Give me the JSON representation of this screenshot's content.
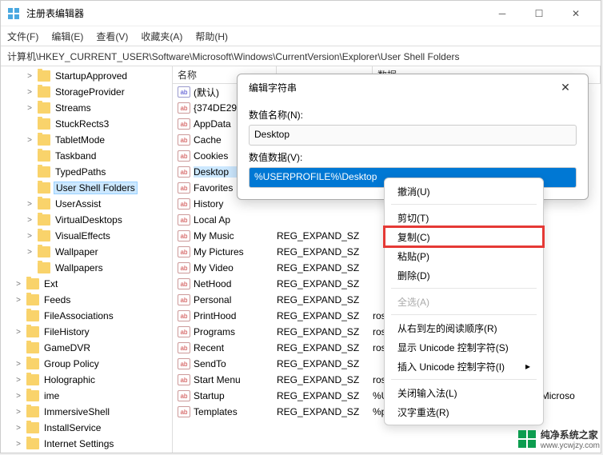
{
  "window": {
    "title": "注册表编辑器",
    "menus": [
      "文件(F)",
      "编辑(E)",
      "查看(V)",
      "收藏夹(A)",
      "帮助(H)"
    ],
    "address": "计算机\\HKEY_CURRENT_USER\\Software\\Microsoft\\Windows\\CurrentVersion\\Explorer\\User Shell Folders"
  },
  "tree": [
    {
      "label": "StartupApproved",
      "lvl": 1,
      "exp": ">"
    },
    {
      "label": "StorageProvider",
      "lvl": 1,
      "exp": ">"
    },
    {
      "label": "Streams",
      "lvl": 1,
      "exp": ">"
    },
    {
      "label": "StuckRects3",
      "lvl": 1,
      "exp": ""
    },
    {
      "label": "TabletMode",
      "lvl": 1,
      "exp": ">"
    },
    {
      "label": "Taskband",
      "lvl": 1,
      "exp": ""
    },
    {
      "label": "TypedPaths",
      "lvl": 1,
      "exp": ""
    },
    {
      "label": "User Shell Folders",
      "lvl": 1,
      "exp": "",
      "selected": true
    },
    {
      "label": "UserAssist",
      "lvl": 1,
      "exp": ">"
    },
    {
      "label": "VirtualDesktops",
      "lvl": 1,
      "exp": ">"
    },
    {
      "label": "VisualEffects",
      "lvl": 1,
      "exp": ">"
    },
    {
      "label": "Wallpaper",
      "lvl": 1,
      "exp": ">"
    },
    {
      "label": "Wallpapers",
      "lvl": 1,
      "exp": ""
    },
    {
      "label": "Ext",
      "lvl": 0,
      "exp": ">"
    },
    {
      "label": "Feeds",
      "lvl": 0,
      "exp": ">"
    },
    {
      "label": "FileAssociations",
      "lvl": 0,
      "exp": ""
    },
    {
      "label": "FileHistory",
      "lvl": 0,
      "exp": ">"
    },
    {
      "label": "GameDVR",
      "lvl": 0,
      "exp": ""
    },
    {
      "label": "Group Policy",
      "lvl": 0,
      "exp": ">"
    },
    {
      "label": "Holographic",
      "lvl": 0,
      "exp": ">"
    },
    {
      "label": "ime",
      "lvl": 0,
      "exp": ">"
    },
    {
      "label": "ImmersiveShell",
      "lvl": 0,
      "exp": ">"
    },
    {
      "label": "InstallService",
      "lvl": 0,
      "exp": ">"
    },
    {
      "label": "Internet Settings",
      "lvl": 0,
      "exp": ">"
    }
  ],
  "list": {
    "headers": {
      "name": "名称",
      "type": "",
      "data": "数据"
    },
    "rows": [
      {
        "name": "(默认)",
        "type": "",
        "data": "",
        "def": true
      },
      {
        "name": "{374DE29",
        "type": "",
        "data": ""
      },
      {
        "name": "AppData",
        "type": "",
        "data": ""
      },
      {
        "name": "Cache",
        "type": "",
        "data": ""
      },
      {
        "name": "Cookies",
        "type": "",
        "data": ""
      },
      {
        "name": "Desktop",
        "type": "",
        "data": "",
        "selected": true
      },
      {
        "name": "Favorites",
        "type": "",
        "data": ""
      },
      {
        "name": "History",
        "type": "",
        "data": ""
      },
      {
        "name": "Local Ap",
        "type": "",
        "data": ""
      },
      {
        "name": "My Music",
        "type": "REG_EXPAND_SZ",
        "data": ""
      },
      {
        "name": "My Pictures",
        "type": "REG_EXPAND_SZ",
        "data": ""
      },
      {
        "name": "My Video",
        "type": "REG_EXPAND_SZ",
        "data": ""
      },
      {
        "name": "NetHood",
        "type": "REG_EXPAND_SZ",
        "data": ""
      },
      {
        "name": "Personal",
        "type": "REG_EXPAND_SZ",
        "data": ""
      },
      {
        "name": "PrintHood",
        "type": "REG_EXPAND_SZ",
        "data": "roso"
      },
      {
        "name": "Programs",
        "type": "REG_EXPAND_SZ",
        "data": "roso"
      },
      {
        "name": "Recent",
        "type": "REG_EXPAND_SZ",
        "data": "roso"
      },
      {
        "name": "SendTo",
        "type": "REG_EXPAND_SZ",
        "data": ""
      },
      {
        "name": "Start Menu",
        "type": "REG_EXPAND_SZ",
        "data": "roso"
      },
      {
        "name": "Startup",
        "type": "REG_EXPAND_SZ",
        "data": "%USERPROFILE%\\AppData\\Roaming\\Microso"
      },
      {
        "name": "Templates",
        "type": "REG_EXPAND_SZ",
        "data": "%plates            REG_EXPAND_SZ      %lat"
      }
    ]
  },
  "dialog": {
    "title": "编辑字符串",
    "name_label": "数值名称(N):",
    "name_value": "Desktop",
    "data_label": "数值数据(V):",
    "data_value": "%USERPROFILE%\\Desktop"
  },
  "ctxmenu": [
    {
      "label": "撤消(U)"
    },
    {
      "sep": true
    },
    {
      "label": "剪切(T)"
    },
    {
      "label": "复制(C)",
      "highlight": true
    },
    {
      "label": "粘贴(P)"
    },
    {
      "label": "删除(D)"
    },
    {
      "sep": true
    },
    {
      "label": "全选(A)",
      "disabled": true
    },
    {
      "sep": true
    },
    {
      "label": "从右到左的阅读顺序(R)"
    },
    {
      "label": "显示 Unicode 控制字符(S)"
    },
    {
      "label": "插入 Unicode 控制字符(I)",
      "arrow": true
    },
    {
      "sep": true
    },
    {
      "label": "关闭输入法(L)"
    },
    {
      "label": "汉字重选(R)"
    }
  ],
  "watermark": {
    "name": "纯净系统之家",
    "url": "www.ycwjzy.com"
  }
}
